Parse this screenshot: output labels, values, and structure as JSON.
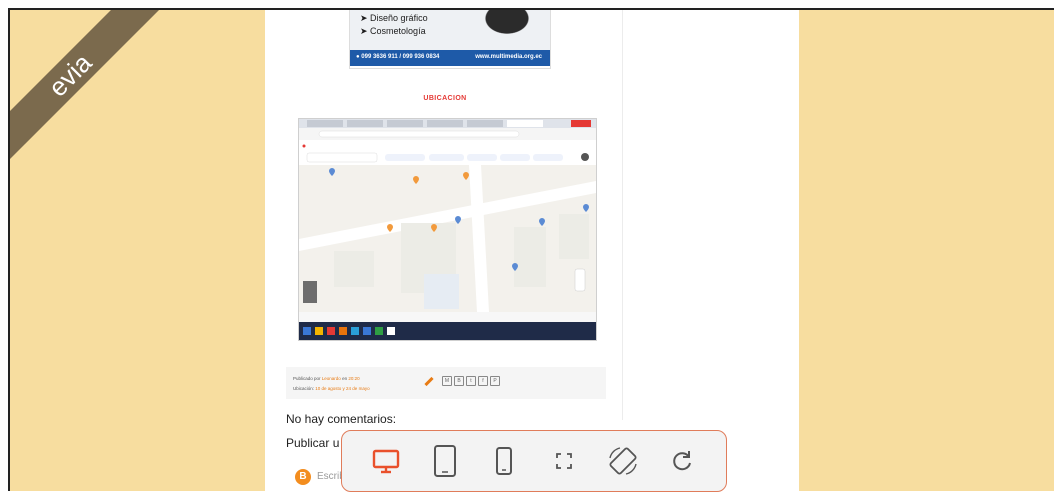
{
  "ribbon": {
    "text": "evia"
  },
  "ad": {
    "lines": [
      "➤ Diseño gráfico",
      "➤ Cosmetología"
    ],
    "phone": "● 099 3636 911 / 099 936 0834",
    "website": "www.multimedia.org.ec"
  },
  "post": {
    "section_heading": "UBICACION",
    "published_by_prefix": "Publicado por",
    "author": "Leonardo",
    "at_word": "en",
    "time": "20:20",
    "location_prefix": "Ubicación:",
    "location": "10 de agosto y 24 de mayo"
  },
  "comments": {
    "no_comments": "No hay comentarios:",
    "publish": "Publicar u",
    "input_placeholder": "Escrib"
  },
  "toolbar": {
    "accent_color": "#e9502b",
    "icon_color": "#555555",
    "buttons": [
      {
        "name": "desktop-view",
        "icon": "desktop-icon",
        "active": true
      },
      {
        "name": "tablet-view",
        "icon": "tablet-icon",
        "active": false
      },
      {
        "name": "mobile-view",
        "icon": "mobile-icon",
        "active": false
      },
      {
        "name": "fullscreen",
        "icon": "fullscreen-icon",
        "active": false
      },
      {
        "name": "rotate",
        "icon": "rotate-icon",
        "active": false
      },
      {
        "name": "reload",
        "icon": "reload-icon",
        "active": false
      }
    ]
  }
}
